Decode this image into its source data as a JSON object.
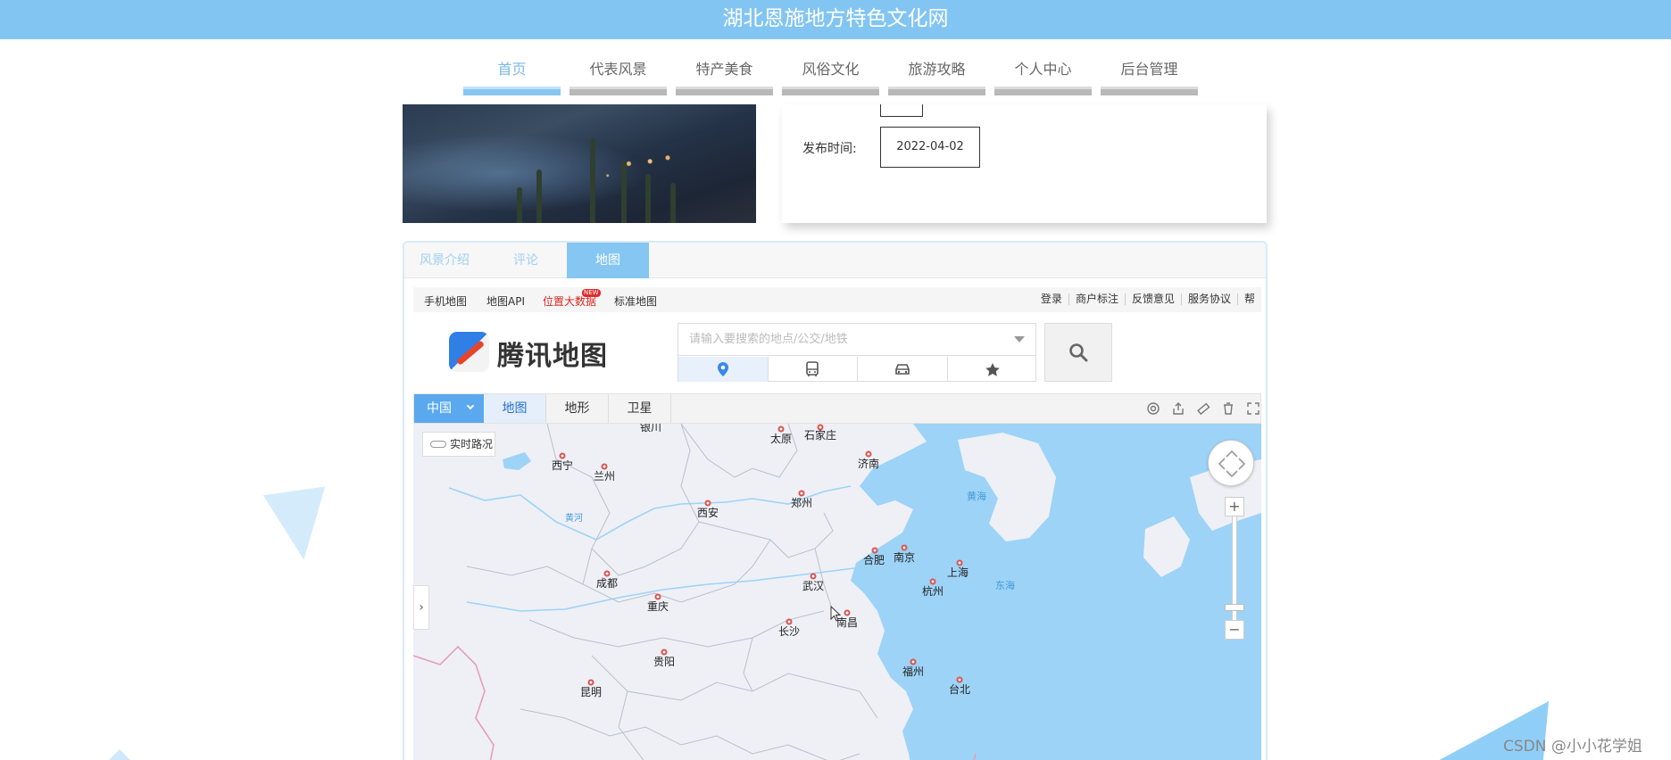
{
  "site": {
    "title": "湖北恩施地方特色文化网"
  },
  "nav": {
    "items": [
      {
        "label": "首页",
        "active": true
      },
      {
        "label": "代表风景",
        "active": false
      },
      {
        "label": "特产美食",
        "active": false
      },
      {
        "label": "风俗文化",
        "active": false
      },
      {
        "label": "旅游攻略",
        "active": false
      },
      {
        "label": "个人中心",
        "active": false
      },
      {
        "label": "后台管理",
        "active": false
      }
    ]
  },
  "detail": {
    "publish_label": "发布时间:",
    "publish_date": "2022-04-02"
  },
  "tabs": {
    "intro": "风景介绍",
    "comment": "评论",
    "map": "地图",
    "active": "地图"
  },
  "map": {
    "topbar": {
      "mobile": "手机地图",
      "api": "地图API",
      "bigdata": "位置大数据",
      "bigdata_badge": "NEW",
      "standard": "标准地图",
      "login": "登录",
      "merchant": "商户标注",
      "feedback": "反馈意见",
      "terms": "服务协议",
      "help": "帮"
    },
    "brand": "腾讯地图",
    "search": {
      "placeholder": "请输入要搜索的地点/公交/地铁"
    },
    "modes": [
      "location-icon",
      "bus-icon",
      "car-icon",
      "star-icon"
    ],
    "region": "中国",
    "types": {
      "map": "地图",
      "terrain": "地形",
      "satellite": "卫星",
      "active": "地图"
    },
    "traffic": "实时路况",
    "cities": [
      "银川",
      "太原",
      "石家庄",
      "西宁",
      "兰州",
      "济南",
      "郑州",
      "西安",
      "合肥",
      "南京",
      "上海",
      "成都",
      "武汉",
      "杭州",
      "重庆",
      "长沙",
      "南昌",
      "贵阳",
      "福州",
      "昆明",
      "台北"
    ],
    "seas": {
      "yellow_sea": "黄海",
      "east_sea": "东海"
    },
    "river": "黄河",
    "colors": {
      "water": "#9dd3f7",
      "land": "#eef0f6",
      "region_button": "#5aa8ee"
    }
  },
  "colors": {
    "header": "#82c5f2",
    "nav_active": "#86c6f2",
    "nav_inactive": "#b8b8b8"
  },
  "watermark": "CSDN @小小花学姐"
}
